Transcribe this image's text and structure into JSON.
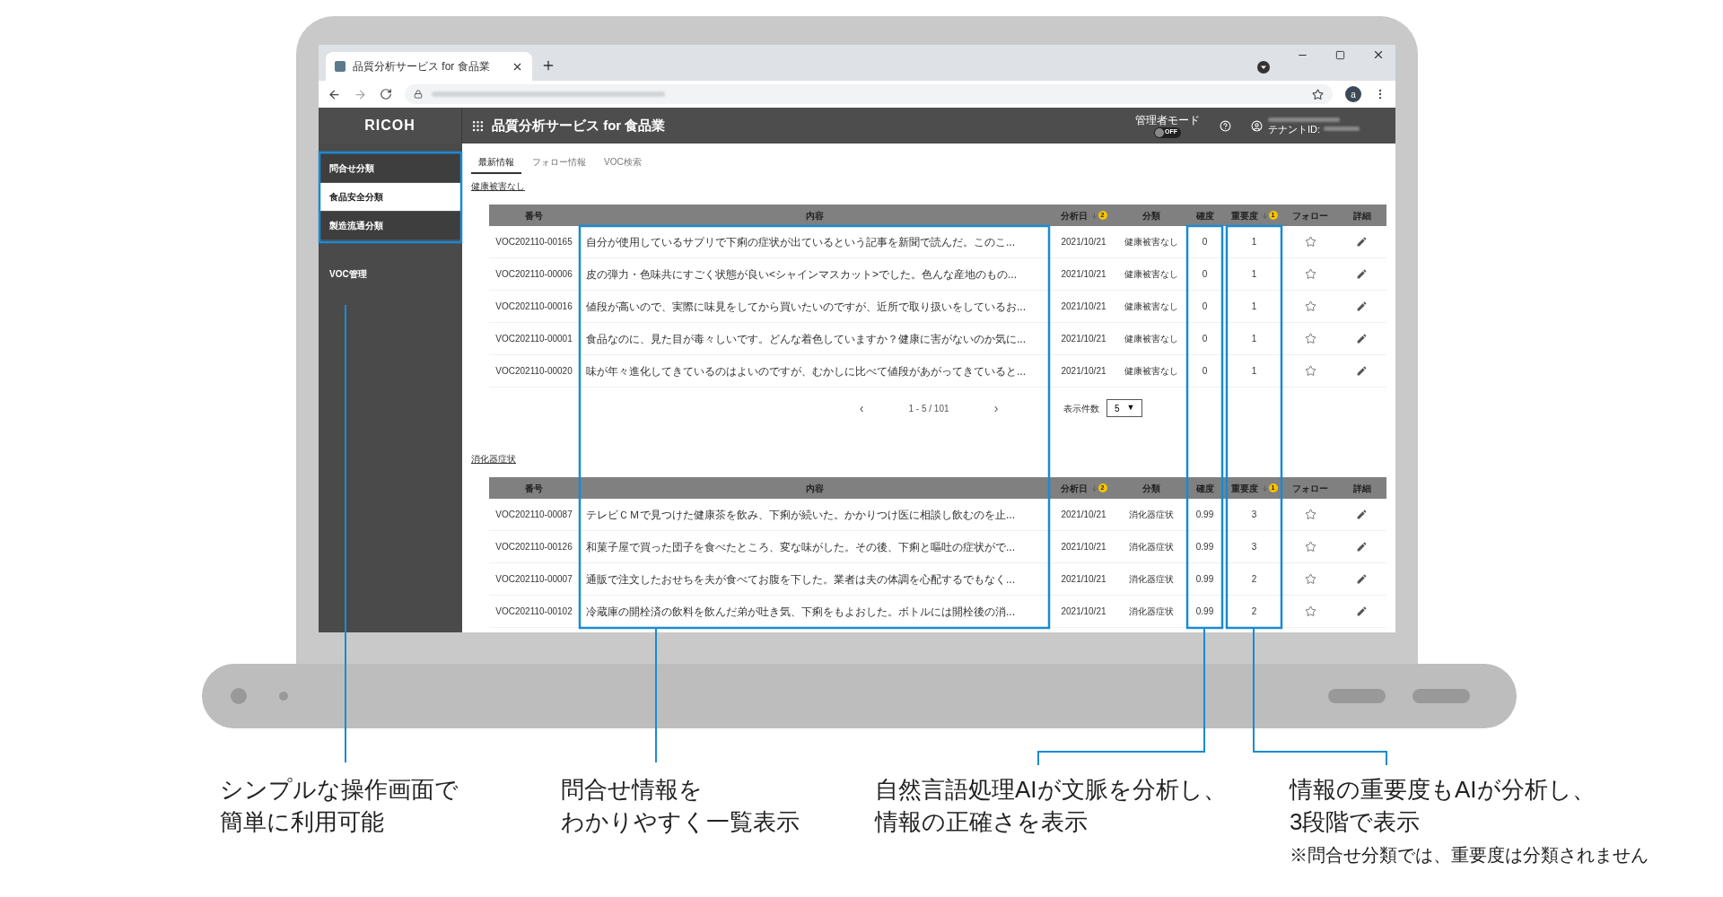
{
  "browser": {
    "tab_title": "品質分析サービス for 食品業",
    "avatar": "a"
  },
  "app": {
    "logo": "RICOH",
    "title": "品質分析サービス for 食品業",
    "admin_mode": {
      "label": "管理者モード",
      "on": false,
      "state_label": "OFF"
    },
    "tenant_label": "テナントID:"
  },
  "sidebar": {
    "items": [
      {
        "label": "問合せ分類",
        "selected": false
      },
      {
        "label": "食品安全分類",
        "selected": true
      },
      {
        "label": "製造流通分類",
        "selected": false
      }
    ],
    "section": "VOC管理"
  },
  "tabs": [
    {
      "label": "最新情報",
      "selected": true
    },
    {
      "label": "フォロー情報",
      "selected": false
    },
    {
      "label": "VOC検索",
      "selected": false
    }
  ],
  "sections": [
    {
      "title": "健康被害なし",
      "columns": [
        {
          "label": "番号"
        },
        {
          "label": "内容"
        },
        {
          "label": "分析日",
          "sort": "2"
        },
        {
          "label": "分類"
        },
        {
          "label": "確度"
        },
        {
          "label": "重要度",
          "sort": "1"
        },
        {
          "label": "フォロー"
        },
        {
          "label": "詳細"
        }
      ],
      "rows": [
        {
          "id": "VOC202110-00165",
          "content": "自分が使用しているサプリで下痢の症状が出ているという記事を新聞で読んだ。このこ...",
          "date": "2021/10/21",
          "category": "健康被害なし",
          "confidence": "0",
          "importance": "1",
          "followed": false
        },
        {
          "id": "VOC202110-00006",
          "content": "皮の弾力・色味共にすごく状態が良い<シャインマスカット>でした。色んな産地のもの...",
          "date": "2021/10/21",
          "category": "健康被害なし",
          "confidence": "0",
          "importance": "1",
          "followed": false
        },
        {
          "id": "VOC202110-00016",
          "content": "値段が高いので、実際に味見をしてから買いたいのですが、近所で取り扱いをしているお...",
          "date": "2021/10/21",
          "category": "健康被害なし",
          "confidence": "0",
          "importance": "1",
          "followed": false
        },
        {
          "id": "VOC202110-00001",
          "content": "食品なのに、見た目が毒々しいです。どんな着色していますか？健康に害がないのか気に...",
          "date": "2021/10/21",
          "category": "健康被害なし",
          "confidence": "0",
          "importance": "1",
          "followed": false
        },
        {
          "id": "VOC202110-00020",
          "content": "味が年々進化してきているのはよいのですが、むかしに比べて値段があがってきていると...",
          "date": "2021/10/21",
          "category": "健康被害なし",
          "confidence": "0",
          "importance": "1",
          "followed": false
        }
      ],
      "pagination": {
        "prev": "‹",
        "range": "1 - 5 / 101",
        "next": "›",
        "per_page_label": "表示件数",
        "per_page": "5",
        "caret": "▼"
      }
    },
    {
      "title": "消化器症状",
      "columns": [
        {
          "label": "番号"
        },
        {
          "label": "内容"
        },
        {
          "label": "分析日",
          "sort": "2"
        },
        {
          "label": "分類"
        },
        {
          "label": "確度"
        },
        {
          "label": "重要度",
          "sort": "1"
        },
        {
          "label": "フォロー"
        },
        {
          "label": "詳細"
        }
      ],
      "rows": [
        {
          "id": "VOC202110-00087",
          "content": "テレビＣＭで見つけた健康茶を飲み、下痢が続いた。かかりつけ医に相談し飲むのを止...",
          "date": "2021/10/21",
          "category": "消化器症状",
          "confidence": "0.99",
          "importance": "3",
          "followed": false
        },
        {
          "id": "VOC202110-00126",
          "content": "和菓子屋で買った団子を食べたところ、変な味がした。その後、下痢と嘔吐の症状がで...",
          "date": "2021/10/21",
          "category": "消化器症状",
          "confidence": "0.99",
          "importance": "3",
          "followed": false
        },
        {
          "id": "VOC202110-00007",
          "content": "通販で注文したおせちを夫が食べてお腹を下した。業者は夫の体調を心配するでもなく...",
          "date": "2021/10/21",
          "category": "消化器症状",
          "confidence": "0.99",
          "importance": "2",
          "followed": false
        },
        {
          "id": "VOC202110-00102",
          "content": "冷蔵庫の開栓済の飲料を飲んだ弟が吐き気、下痢をもよおした。ボトルには開栓後の消...",
          "date": "2021/10/21",
          "category": "消化器症状",
          "confidence": "0.99",
          "importance": "2",
          "followed": false
        }
      ]
    }
  ],
  "callouts": [
    {
      "lines": [
        "シンプルな操作画面で",
        "簡単に利用可能"
      ]
    },
    {
      "lines": [
        "問合せ情報を",
        "わかりやすく一覧表示"
      ]
    },
    {
      "lines": [
        "自然言語処理AIが文脈を分析し、",
        "情報の正確さを表示"
      ]
    },
    {
      "lines": [
        "情報の重要度もAIが分析し、",
        "3段階で表示"
      ],
      "note": "※問合せ分類では、重要度は分類されません"
    }
  ]
}
